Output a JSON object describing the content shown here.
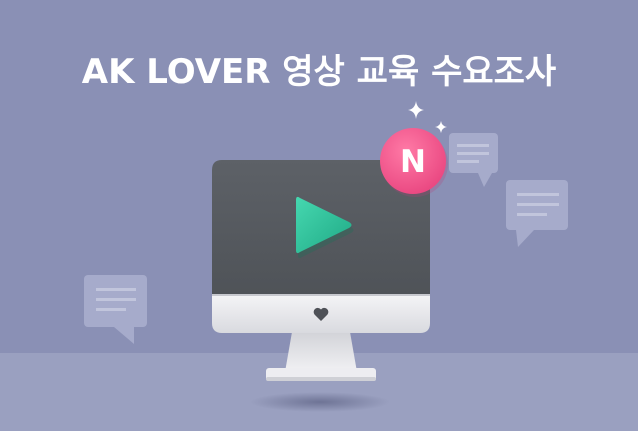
{
  "banner": {
    "title": "AK LOVER 영상 교육 수요조사",
    "badge_letter": "N"
  },
  "colors": {
    "background": "#8a90b5",
    "floor": "#9aa0c0",
    "monitor_screen": "#565a60",
    "play_button": "#2fc79f",
    "badge": "#f1588a",
    "speech_bubble": "#a6abcb"
  },
  "icons": [
    "play-icon",
    "heart-icon",
    "sparkle-icon",
    "speech-bubble-icon"
  ]
}
